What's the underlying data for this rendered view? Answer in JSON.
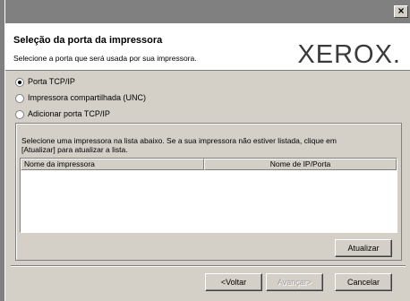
{
  "window": {
    "close_glyph": "×"
  },
  "header": {
    "title": "Seleção da porta da impressora",
    "subtitle": "Selecione a porta que será usada por sua impressora.",
    "logo": "XEROX."
  },
  "options": [
    {
      "label": "Porta TCP/IP",
      "selected": true
    },
    {
      "label": "Impressora compartilhada (UNC)",
      "selected": false
    },
    {
      "label": "Adicionar porta TCP/IP",
      "selected": false
    }
  ],
  "printer_list": {
    "instruction_line1": "Selecione uma impressora na lista abaixo. Se a sua impressora não estiver listada, clique em",
    "instruction_line2": "[Atualizar] para atualizar a lista.",
    "col_name": "Nome da impressora",
    "col_port": "Nome de IP/Porta",
    "refresh_label": "Atualizar"
  },
  "footer": {
    "back_label": "<Voltar",
    "next_label": "Avançar>",
    "cancel_label": "Cancelar"
  }
}
